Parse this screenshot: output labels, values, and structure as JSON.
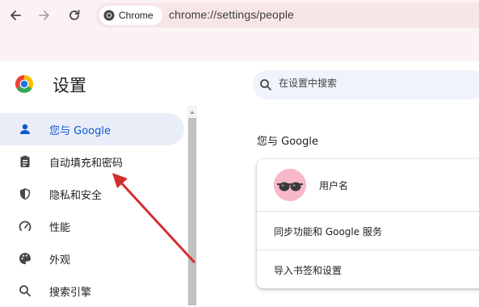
{
  "browser": {
    "chip_label": "Chrome",
    "url": "chrome://settings/people"
  },
  "header": {
    "title": "设置",
    "search_placeholder": "在设置中搜索"
  },
  "sidebar": {
    "items": [
      {
        "label": "您与 Google",
        "icon": "person-icon",
        "active": true
      },
      {
        "label": "自动填充和密码",
        "icon": "clipboard-icon",
        "active": false
      },
      {
        "label": "隐私和安全",
        "icon": "shield-icon",
        "active": false
      },
      {
        "label": "性能",
        "icon": "gauge-icon",
        "active": false
      },
      {
        "label": "外观",
        "icon": "palette-icon",
        "active": false
      },
      {
        "label": "搜索引擎",
        "icon": "search-icon",
        "active": false
      }
    ]
  },
  "main": {
    "section_title": "您与 Google",
    "card": {
      "username": "用户名",
      "sync_label": "同步功能和 Google 服务",
      "import_label": "导入书签和设置"
    }
  },
  "colors": {
    "accent": "#0b57d0",
    "active_bg": "#e9eef8",
    "annotation_arrow": "#d32f2f"
  }
}
